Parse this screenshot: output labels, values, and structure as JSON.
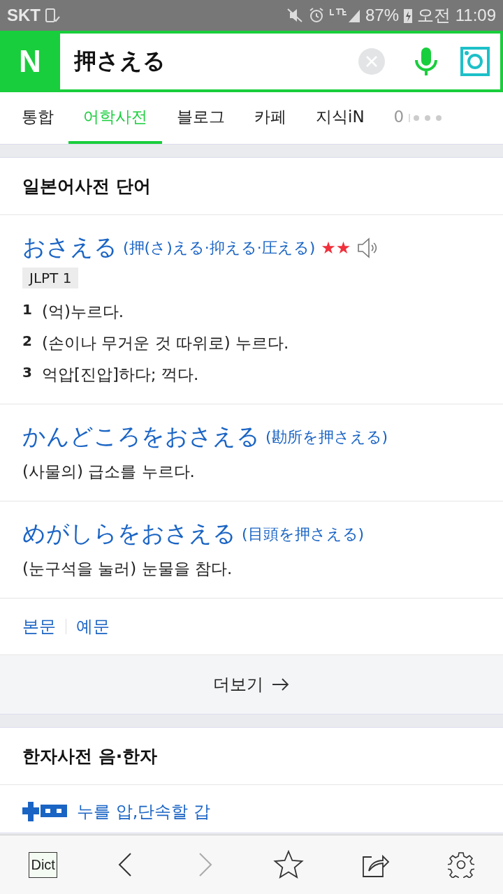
{
  "status_bar": {
    "carrier": "SKT",
    "battery": "87%",
    "time": "오전 11:09"
  },
  "search": {
    "logo": "N",
    "value": "押さえる"
  },
  "tabs": [
    {
      "label": "통합",
      "selected": false,
      "faded": false
    },
    {
      "label": "어학사전",
      "selected": true,
      "faded": false
    },
    {
      "label": "블로그",
      "selected": false,
      "faded": false
    },
    {
      "label": "카페",
      "selected": false,
      "faded": false
    },
    {
      "label": "지식iN",
      "selected": false,
      "faded": false
    },
    {
      "label": "0",
      "selected": false,
      "faded": true
    }
  ],
  "word_section": {
    "title": "일본어사전 단어",
    "main_entry": {
      "word": "おさえる",
      "kanji": "(押(さ)える·抑える·圧える)",
      "importance": "★★",
      "badge": "JLPT 1",
      "meanings": [
        {
          "number": "1",
          "text": "(억)누르다."
        },
        {
          "number": "2",
          "text": "(손이나 무거운 것 따위로) 누르다."
        },
        {
          "number": "3",
          "text": "억압[진압]하다; 꺽다."
        }
      ]
    },
    "phrases": [
      {
        "word": "かんどころをおさえる",
        "kanji": "(勘所を押さえる)",
        "meaning": "(사물의) 급소를 누르다."
      },
      {
        "word": "めがしらをおさえる",
        "kanji": "(目頭を押さえる)",
        "meaning": "(눈구석을 눌러) 눈물을 참다."
      }
    ],
    "links": [
      "본문",
      "예문"
    ],
    "more": "더보기"
  },
  "hanja_section": {
    "title": "한자사전 음·한자",
    "entry": "누를 압,단속할 갑"
  },
  "toolbar": {
    "dict_label": "Dict",
    "back_disabled": false,
    "forward_disabled": true
  }
}
